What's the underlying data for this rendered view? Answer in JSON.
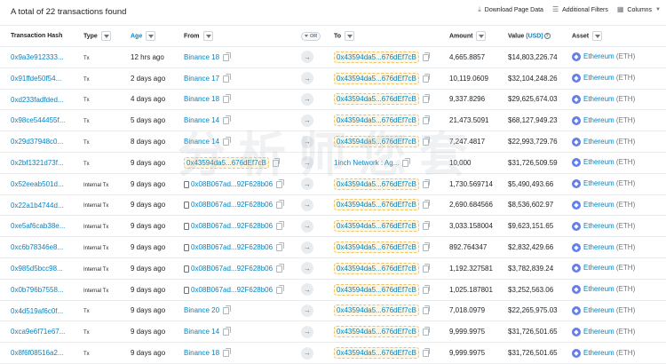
{
  "header": {
    "total": "A total of 22 transactions found",
    "download": "Download Page Data",
    "filters": "Additional Filters",
    "columns": "Columns"
  },
  "columns": {
    "hash": "Transaction Hash",
    "type": "Type",
    "age": "Age",
    "from": "From",
    "or": "OR",
    "to": "To",
    "amount": "Amount",
    "value": "Value",
    "value_unit": "(USD)",
    "asset": "Asset"
  },
  "watermark": "分析师您套",
  "rows": [
    {
      "hash": "0x9a3e912333...",
      "type": "Tx",
      "age": "12 hrs ago",
      "from": "Binance 18",
      "to": "0x43594da5...676dEf7cB",
      "amount": "4,665.8857",
      "value": "$14,803,226.74",
      "asset": "Ethereum",
      "ticker": "(ETH)"
    },
    {
      "hash": "0x91ffde50f54...",
      "type": "Tx",
      "age": "2 days ago",
      "from": "Binance 17",
      "to": "0x43594da5...676dEf7cB",
      "amount": "10,119.0609",
      "value": "$32,104,248.26",
      "asset": "Ethereum",
      "ticker": "(ETH)"
    },
    {
      "hash": "0xd233fadfded...",
      "type": "Tx",
      "age": "4 days ago",
      "from": "Binance 18",
      "to": "0x43594da5...676dEf7cB",
      "amount": "9,337.8296",
      "value": "$29,625,674.03",
      "asset": "Ethereum",
      "ticker": "(ETH)"
    },
    {
      "hash": "0x98ce544455f...",
      "type": "Tx",
      "age": "5 days ago",
      "from": "Binance 14",
      "to": "0x43594da5...676dEf7cB",
      "amount": "21,473.5091",
      "value": "$68,127,949.23",
      "asset": "Ethereum",
      "ticker": "(ETH)"
    },
    {
      "hash": "0x29d37948c0...",
      "type": "Tx",
      "age": "8 days ago",
      "from": "Binance 14",
      "to": "0x43594da5...676dEf7cB",
      "amount": "7,247.4817",
      "value": "$22,993,729.76",
      "asset": "Ethereum",
      "ticker": "(ETH)"
    },
    {
      "hash": "0x2bf1321d73f...",
      "type": "Tx",
      "age": "9 days ago",
      "from": "0x43594da5...676dEf7cB",
      "to": "1inch Network : Ag...",
      "amount": "10,000",
      "value": "$31,726,509.59",
      "asset": "Ethereum",
      "ticker": "(ETH)"
    },
    {
      "hash": "0x52eeab501d...",
      "type": "Internal Tx",
      "age": "9 days ago",
      "from": "0x08B067ad...92F628b06",
      "to": "0x43594da5...676dEf7cB",
      "amount": "1,730.569714",
      "value": "$5,490,493.66",
      "asset": "Ethereum",
      "ticker": "(ETH)"
    },
    {
      "hash": "0x22a1b4744d...",
      "type": "Internal Tx",
      "age": "9 days ago",
      "from": "0x08B067ad...92F628b06",
      "to": "0x43594da5...676dEf7cB",
      "amount": "2,690.684566",
      "value": "$8,536,602.97",
      "asset": "Ethereum",
      "ticker": "(ETH)"
    },
    {
      "hash": "0xe5af6cab38e...",
      "type": "Internal Tx",
      "age": "9 days ago",
      "from": "0x08B067ad...92F628b06",
      "to": "0x43594da5...676dEf7cB",
      "amount": "3,033.158004",
      "value": "$9,623,151.65",
      "asset": "Ethereum",
      "ticker": "(ETH)"
    },
    {
      "hash": "0xc6b78346e8...",
      "type": "Internal Tx",
      "age": "9 days ago",
      "from": "0x08B067ad...92F628b06",
      "to": "0x43594da5...676dEf7cB",
      "amount": "892.764347",
      "value": "$2,832,429.66",
      "asset": "Ethereum",
      "ticker": "(ETH)"
    },
    {
      "hash": "0x985d5bcc98...",
      "type": "Internal Tx",
      "age": "9 days ago",
      "from": "0x08B067ad...92F628b06",
      "to": "0x43594da5...676dEf7cB",
      "amount": "1,192.327581",
      "value": "$3,782,839.24",
      "asset": "Ethereum",
      "ticker": "(ETH)"
    },
    {
      "hash": "0x0b796b7558...",
      "type": "Internal Tx",
      "age": "9 days ago",
      "from": "0x08B067ad...92F628b06",
      "to": "0x43594da5...676dEf7cB",
      "amount": "1,025.187801",
      "value": "$3,252,563.06",
      "asset": "Ethereum",
      "ticker": "(ETH)"
    },
    {
      "hash": "0x4d519af6c0f...",
      "type": "Tx",
      "age": "9 days ago",
      "from": "Binance 20",
      "to": "0x43594da5...676dEf7cB",
      "amount": "7,018.0979",
      "value": "$22,265,975.03",
      "asset": "Ethereum",
      "ticker": "(ETH)"
    },
    {
      "hash": "0xca9e6f71e67...",
      "type": "Tx",
      "age": "9 days ago",
      "from": "Binance 14",
      "to": "0x43594da5...676dEf7cB",
      "amount": "9,999.9975",
      "value": "$31,726,501.65",
      "asset": "Ethereum",
      "ticker": "(ETH)"
    },
    {
      "hash": "0x8f6f08516a2...",
      "type": "Tx",
      "age": "9 days ago",
      "from": "Binance 18",
      "to": "0x43594da5...676dEf7cB",
      "amount": "9,999.9975",
      "value": "$31,726,501.65",
      "asset": "Ethereum",
      "ticker": "(ETH)"
    }
  ]
}
